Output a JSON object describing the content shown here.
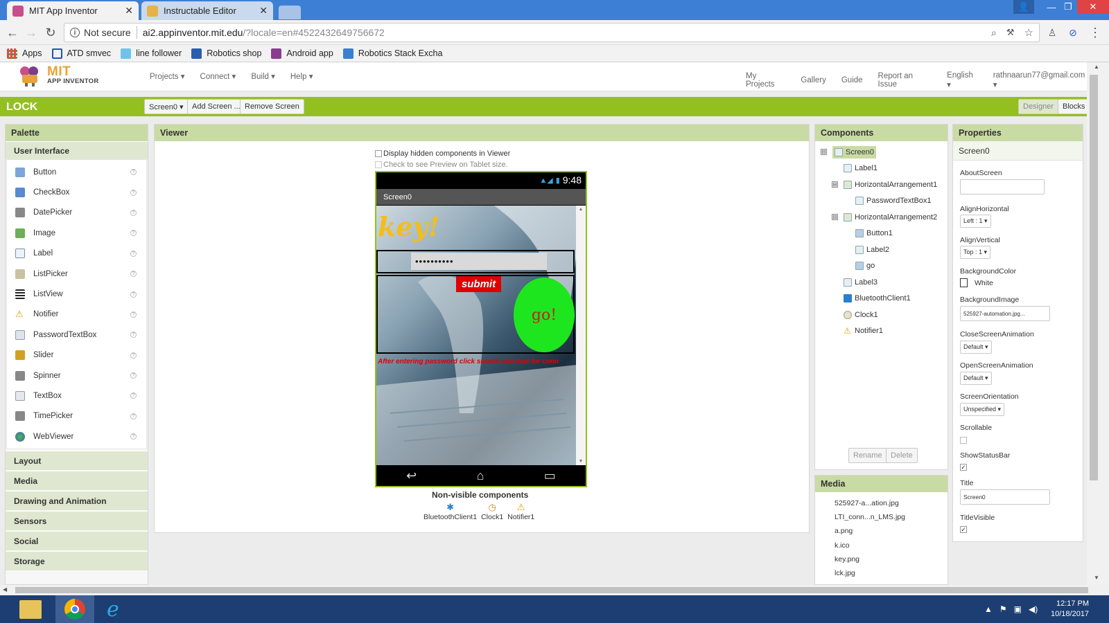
{
  "browser": {
    "tabs": [
      {
        "title": "MIT App Inventor",
        "active": true
      },
      {
        "title": "Instructable Editor",
        "active": false
      }
    ],
    "address": {
      "security": "Not secure",
      "host": "ai2.appinventor.mit.edu",
      "path": "/?locale=en#4522432649756672"
    },
    "bookmarks": [
      "Apps",
      "ATD smvec",
      "line follower",
      "Robotics shop",
      "Android app",
      "Robotics Stack Excha"
    ]
  },
  "app_header": {
    "logo_line1": "MIT",
    "logo_line2": "APP INVENTOR",
    "menus": [
      "Projects ▾",
      "Connect ▾",
      "Build ▾",
      "Help ▾"
    ],
    "right_links": [
      "My Projects",
      "Gallery",
      "Guide",
      "Report an Issue",
      "English ▾",
      "rathnaarun77@gmail.com ▾"
    ]
  },
  "project_bar": {
    "project_name": "LOCK",
    "screen_select": "Screen0 ▾",
    "add_screen": "Add Screen ...",
    "remove_screen": "Remove Screen",
    "designer": "Designer",
    "blocks": "Blocks"
  },
  "palette": {
    "title": "Palette",
    "open_category": "User Interface",
    "items": [
      "Button",
      "CheckBox",
      "DatePicker",
      "Image",
      "Label",
      "ListPicker",
      "ListView",
      "Notifier",
      "PasswordTextBox",
      "Slider",
      "Spinner",
      "TextBox",
      "TimePicker",
      "WebViewer"
    ],
    "help_glyph": "?",
    "categories": [
      "Layout",
      "Media",
      "Drawing and Animation",
      "Sensors",
      "Social",
      "Storage"
    ]
  },
  "viewer": {
    "title": "Viewer",
    "hidden_label": "Display hidden components in Viewer",
    "tablet_label": "Check to see Preview on Tablet size.",
    "phone": {
      "time": "9:48",
      "screen_title": "Screen0",
      "label1": "key!",
      "password_mask": "••••••••••",
      "button1": "submit",
      "go_label": "go!",
      "label3": "After entering password click submit and wait for conn"
    },
    "nonvisible_title": "Non-visible components",
    "nonvisible": [
      "BluetoothClient1",
      "Clock1",
      "Notifier1"
    ]
  },
  "components": {
    "title": "Components",
    "tree": [
      {
        "name": "Screen0",
        "level": 0,
        "toggle": "⊟",
        "selected": true
      },
      {
        "name": "Label1",
        "level": 1
      },
      {
        "name": "HorizontalArrangement1",
        "level": 1,
        "toggle": "⊟"
      },
      {
        "name": "PasswordTextBox1",
        "level": 2
      },
      {
        "name": "HorizontalArrangement2",
        "level": 1,
        "toggle": "⊟"
      },
      {
        "name": "Button1",
        "level": 2
      },
      {
        "name": "Label2",
        "level": 2
      },
      {
        "name": "go",
        "level": 2
      },
      {
        "name": "Label3",
        "level": 1
      },
      {
        "name": "BluetoothClient1",
        "level": 1
      },
      {
        "name": "Clock1",
        "level": 1
      },
      {
        "name": "Notifier1",
        "level": 1
      }
    ],
    "rename": "Rename",
    "delete": "Delete"
  },
  "media": {
    "title": "Media",
    "files": [
      "525927-a...ation.jpg",
      "LTI_conn...n_LMS.jpg",
      "a.png",
      "k.ico",
      "key.png",
      "lck.jpg"
    ]
  },
  "properties": {
    "title": "Properties",
    "component": "Screen0",
    "about_label": "AboutScreen",
    "about_value": "",
    "align_h_label": "AlignHorizontal",
    "align_h_value": "Left : 1 ▾",
    "align_v_label": "AlignVertical",
    "align_v_value": "Top : 1 ▾",
    "bgcolor_label": "BackgroundColor",
    "bgcolor_value": "White",
    "bgimage_label": "BackgroundImage",
    "bgimage_value": "525927-automation.jpg...",
    "close_anim_label": "CloseScreenAnimation",
    "close_anim_value": "Default ▾",
    "open_anim_label": "OpenScreenAnimation",
    "open_anim_value": "Default ▾",
    "orientation_label": "ScreenOrientation",
    "orientation_value": "Unspecified ▾",
    "scrollable_label": "Scrollable",
    "scrollable": false,
    "statusbar_label": "ShowStatusBar",
    "statusbar": true,
    "title_label": "Title",
    "title_value": "Screen0",
    "titlevisible_label": "TitleVisible",
    "titlevisible": true
  },
  "taskbar": {
    "time": "12:17 PM",
    "date": "10/18/2017"
  },
  "colors": {
    "green_bar": "#93c01f",
    "panel_header": "#c9dba4",
    "go_button": "#1ee61e",
    "submit_button": "#e00000"
  }
}
